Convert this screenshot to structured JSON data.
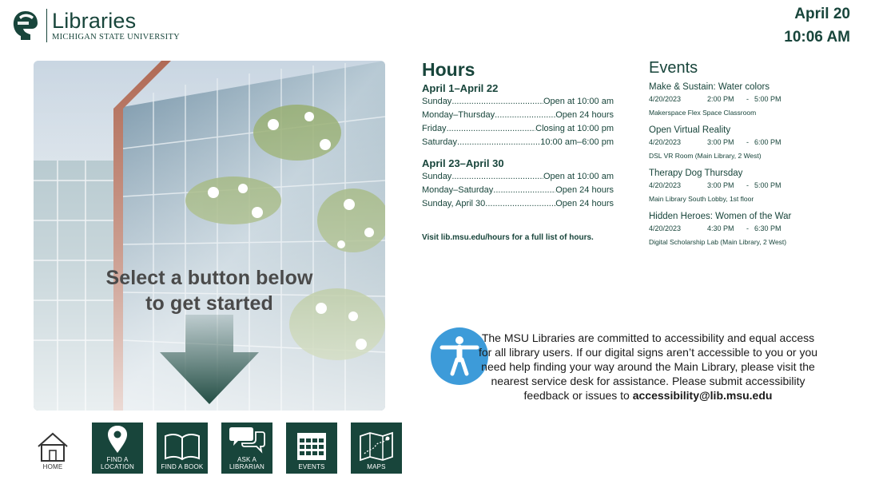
{
  "header": {
    "logo_title": "Libraries",
    "logo_subtitle": "MICHIGAN STATE UNIVERSITY",
    "date": "April 20",
    "time": "10:06 AM"
  },
  "hero": {
    "line1": "Select a button below",
    "line2": "to get started"
  },
  "hours": {
    "title": "Hours",
    "blocks": [
      {
        "range": "April 1–April 22",
        "rows": [
          {
            "day": "Sunday",
            "time": "Open at 10:00 am"
          },
          {
            "day": "Monday–Thursday",
            "time": "Open 24 hours"
          },
          {
            "day": "Friday",
            "time": "Closing at 10:00 pm"
          },
          {
            "day": "Saturday",
            "time": "10:00 am–6:00 pm"
          }
        ]
      },
      {
        "range": "April 23–April 30",
        "rows": [
          {
            "day": "Sunday",
            "time": "Open at 10:00 am"
          },
          {
            "day": "Monday–Saturday",
            "time": "Open 24 hours"
          },
          {
            "day": "Sunday, April 30",
            "time": "Open 24 hours"
          }
        ]
      }
    ],
    "footer": "Visit lib.msu.edu/hours for a full list of hours."
  },
  "events": {
    "title": "Events",
    "items": [
      {
        "name": "Make & Sustain: Water colors",
        "date": "4/20/2023",
        "start": "2:00 PM",
        "dash": "-",
        "end": "5:00 PM",
        "location": "Makerspace Flex Space Classroom"
      },
      {
        "name": "Open Virtual Reality",
        "date": "4/20/2023",
        "start": "3:00 PM",
        "dash": "-",
        "end": "6:00 PM",
        "location": "DSL VR Room (Main Library, 2 West)"
      },
      {
        "name": "Therapy Dog Thursday",
        "date": "4/20/2023",
        "start": "3:00 PM",
        "dash": "-",
        "end": "5:00 PM",
        "location": "Main Library South Lobby, 1st floor"
      },
      {
        "name": "Hidden Heroes: Women of the War",
        "date": "4/20/2023",
        "start": "4:30 PM",
        "dash": "-",
        "end": "6:30 PM",
        "location": "Digital Scholarship Lab (Main Library, 2 West)"
      }
    ]
  },
  "accessibility": {
    "text": "The MSU Libraries are committed to accessibility and equal access for all library users. If our digital signs aren’t accessible to you or you need help finding your way around the Main Library, please visit the nearest service desk for assistance. Please submit accessibility feedback or issues to",
    "email": "accessibility@lib.msu.edu"
  },
  "nav": [
    {
      "label": "HOME",
      "icon": "house-icon"
    },
    {
      "label": "FIND A LOCATION",
      "icon": "map-pin-icon"
    },
    {
      "label": "FIND A BOOK",
      "icon": "open-book-icon"
    },
    {
      "label": "ASK A LIBRARIAN",
      "icon": "speech-bubbles-icon"
    },
    {
      "label": "EVENTS",
      "icon": "calendar-icon"
    },
    {
      "label": "MAPS",
      "icon": "folded-map-icon"
    }
  ],
  "colors": {
    "msu_green": "#18453b",
    "accessibility_blue": "#3d9bd9"
  }
}
